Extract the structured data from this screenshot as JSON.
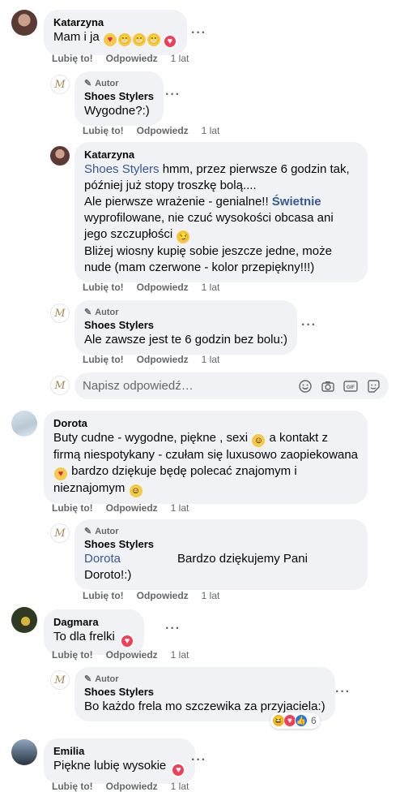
{
  "actions": {
    "like": "Lubię to!",
    "reply": "Odpowiedz"
  },
  "author_badge": "Autor",
  "reply_box": {
    "placeholder": "Napisz odpowiedź…"
  },
  "comments": [
    {
      "name": "Katarzyna",
      "text": "Mam i ja",
      "time": "1 lat"
    },
    {
      "name": "Shoes Stylers",
      "text": "Wygodne?:)",
      "time": "1 lat"
    },
    {
      "name": "Katarzyna",
      "mention": "Shoes Stylers",
      "line1": " hmm, przez pierwsze 6 godzin tak, później już stopy troszkę bolą....",
      "line2a": "Ale pierwsze wrażenie - genialne!! ",
      "line2b": "Świetnie",
      "line2c": " wyprofilowane, nie czuć wysokości obcasa ani jego szczupłości ",
      "line3": "Bliżej wiosny kupię sobie jeszcze jedne, może nude (mam czerwone - kolor przepiękny!!!)",
      "time": "1 lat"
    },
    {
      "name": "Shoes Stylers",
      "text": "Ale zawsze jest te 6 godzin bez bolu:)",
      "time": "1 lat"
    },
    {
      "name": "Dorota",
      "text_a": "Buty cudne - wygodne, piękne , sexi ",
      "text_b": " a kontakt z firmą niespotykany - czułam się luxusowo zaopiekowana ",
      "text_c": " bardzo dziękuje będę polecać znajomym i nieznajomym ",
      "time": "1 lat"
    },
    {
      "name": "Shoes Stylers",
      "mention": "Dorota",
      "text": "Bardzo dziękujemy Pani Doroto!:)",
      "time": "1 lat"
    },
    {
      "name": "Dagmara",
      "text": "To dla frelki",
      "time": "1 lat"
    },
    {
      "name": "Shoes Stylers",
      "text": "Bo każdo frela mo szczewika za przyjaciela:)",
      "time": "1 lat",
      "reaction_count": "6"
    },
    {
      "name": "Emilia",
      "text": "Piękne lubię wysokie",
      "time": "1 lat"
    }
  ],
  "colors": {
    "link": "#385898",
    "bubble": "#f0f2f5",
    "meta": "#65676b",
    "heart": "#f33e58",
    "like": "#1877f2"
  },
  "icons": [
    "more-icon",
    "pencil-icon",
    "emoji-icon",
    "camera-icon",
    "gif-icon",
    "sticker-icon",
    "heart-reaction-icon",
    "haha-reaction-icon",
    "like-reaction-icon"
  ]
}
